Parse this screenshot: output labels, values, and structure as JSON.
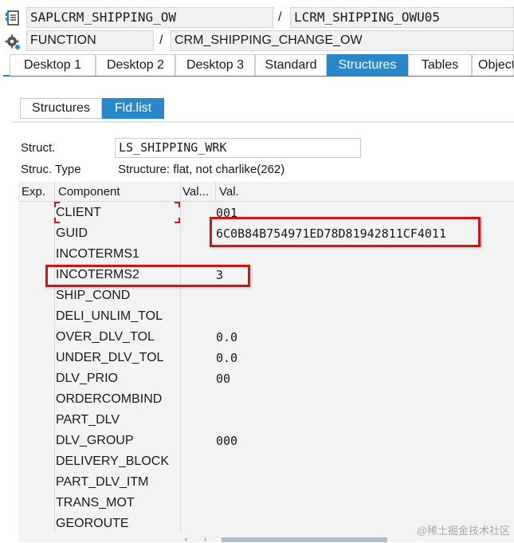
{
  "header": {
    "program": "SAPLCRM_SHIPPING_OW",
    "include": "LCRM_SHIPPING_OWU05",
    "event_type": "FUNCTION",
    "event_name": "CRM_SHIPPING_CHANGE_OW",
    "separator": "/"
  },
  "main_tabs": [
    "Desktop 1",
    "Desktop 2",
    "Desktop 3",
    "Standard",
    "Structures",
    "Tables",
    "Objects"
  ],
  "active_main_tab": "Structures",
  "sub_tabs": [
    "Structures",
    "Fld.list"
  ],
  "active_sub_tab": "Fld.list",
  "struct": {
    "label": "Struct.",
    "value": "LS_SHIPPING_WRK",
    "type_label": "Struc. Type",
    "type_value": "Structure: flat, not charlike(262)"
  },
  "grid": {
    "headers": {
      "exp": "Exp.",
      "component": "Component",
      "val_short": "Val...",
      "val": "Val."
    },
    "rows": [
      {
        "component": "CLIENT",
        "value": "001"
      },
      {
        "component": "GUID",
        "value": "6C0B84B754971ED78D81942811CF4011"
      },
      {
        "component": "INCOTERMS1",
        "value": ""
      },
      {
        "component": "INCOTERMS2",
        "value": "3"
      },
      {
        "component": "SHIP_COND",
        "value": ""
      },
      {
        "component": "DELI_UNLIM_TOL",
        "value": ""
      },
      {
        "component": "OVER_DLV_TOL",
        "value": "0.0"
      },
      {
        "component": "UNDER_DLV_TOL",
        "value": "0.0"
      },
      {
        "component": "DLV_PRIO",
        "value": "00"
      },
      {
        "component": "ORDERCOMBIND",
        "value": ""
      },
      {
        "component": "PART_DLV",
        "value": ""
      },
      {
        "component": "DLV_GROUP",
        "value": "000"
      },
      {
        "component": "DELIVERY_BLOCK",
        "value": ""
      },
      {
        "component": "PART_DLV_ITM",
        "value": ""
      },
      {
        "component": "TRANS_MOT",
        "value": ""
      },
      {
        "component": "GEOROUTE",
        "value": ""
      }
    ]
  },
  "watermark": "@稀土掘金技术社区",
  "colors": {
    "accent": "#2a88c8",
    "highlight": "#d11414"
  },
  "icons": [
    "program-icon",
    "gear-icon",
    "scroll-left-icon",
    "scroll-right-icon"
  ]
}
